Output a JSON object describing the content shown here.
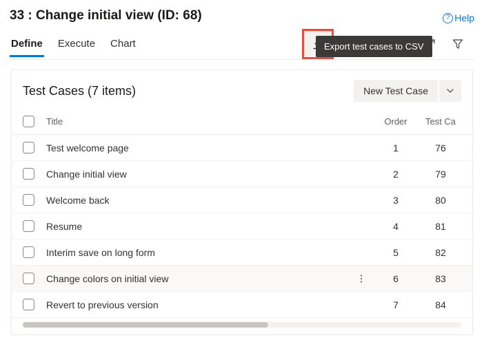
{
  "page_title": "33 : Change initial view (ID: 68)",
  "help_label": "Help",
  "tabs": [
    {
      "label": "Define",
      "active": true
    },
    {
      "label": "Execute",
      "active": false
    },
    {
      "label": "Chart",
      "active": false
    }
  ],
  "toolbar": {
    "export_tooltip": "Export test cases to CSV"
  },
  "panel": {
    "title": "Test Cases (7 items)",
    "new_button": "New Test Case"
  },
  "columns": {
    "title": "Title",
    "order": "Order",
    "test_case": "Test Ca"
  },
  "rows": [
    {
      "title": "Test welcome page",
      "order": "1",
      "tc": "76"
    },
    {
      "title": "Change initial view",
      "order": "2",
      "tc": "79"
    },
    {
      "title": "Welcome back",
      "order": "3",
      "tc": "80"
    },
    {
      "title": "Resume",
      "order": "4",
      "tc": "81"
    },
    {
      "title": "Interim save on long form",
      "order": "5",
      "tc": "82"
    },
    {
      "title": "Change colors on initial view",
      "order": "6",
      "tc": "83",
      "hovered": true
    },
    {
      "title": "Revert to previous version",
      "order": "7",
      "tc": "84"
    }
  ]
}
